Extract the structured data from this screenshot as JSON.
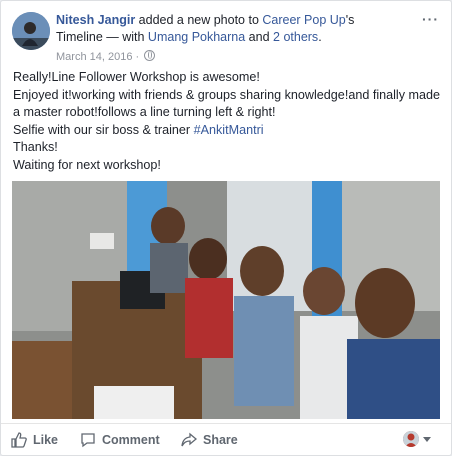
{
  "post": {
    "author": "Nitesh Jangir",
    "action_text": " added a new photo to ",
    "target_page": "Career Pop Up",
    "possessive": "'s",
    "timeline_with": " Timeline — with ",
    "tagged_person": "Umang Pokharna",
    "and_text": " and ",
    "others": "2 others",
    "period": ".",
    "date": "March 14, 2016",
    "date_sep": " · ",
    "more_icon": "more-options-icon",
    "text_lines": [
      "Really!Line Follower Workshop is awesome!",
      "Enjoyed it!working with friends & groups sharing knowledge!and finally made a master robot!follows a line turning left & right!",
      "Selfie with our sir boss & trainer ",
      "Thanks!",
      "Waiting for next workshop!"
    ],
    "hashtag": "#AnkitMantri"
  },
  "actions": {
    "like": "Like",
    "comment": "Comment",
    "share": "Share"
  },
  "colors": {
    "link": "#365899",
    "text": "#1d2129",
    "meta": "#90949c",
    "action": "#606770"
  }
}
